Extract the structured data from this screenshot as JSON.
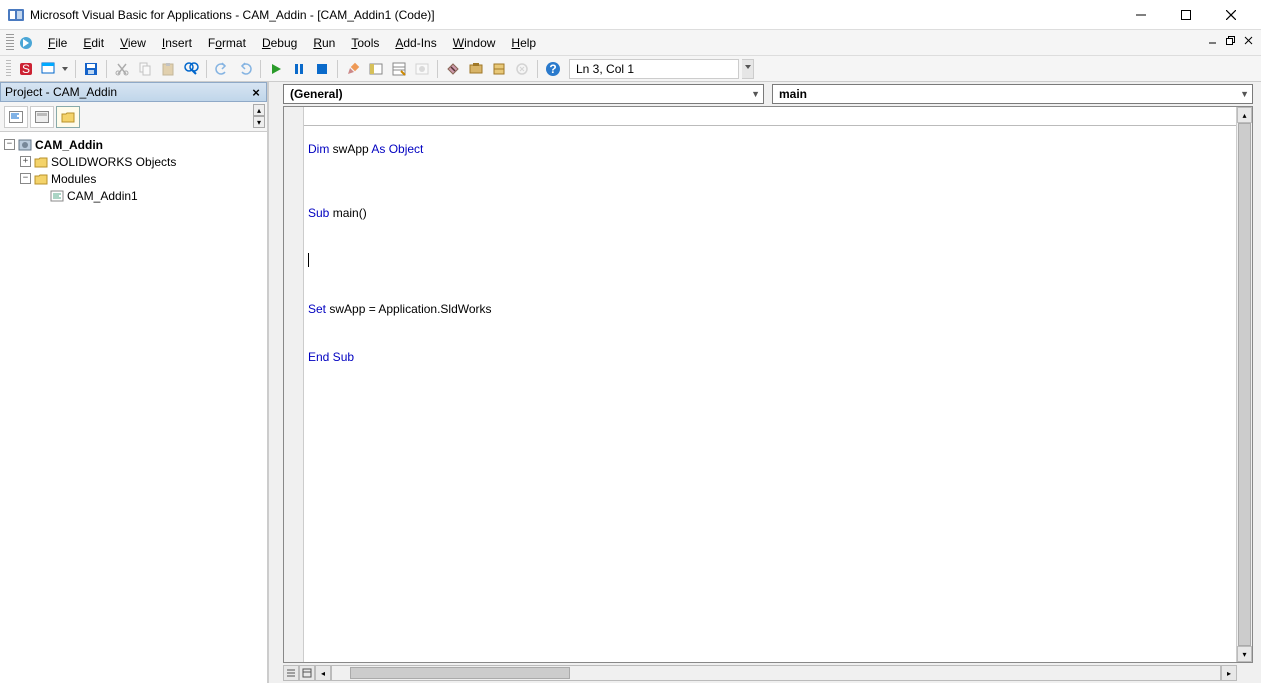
{
  "title": "Microsoft Visual Basic for Applications - CAM_Addin - [CAM_Addin1 (Code)]",
  "menus": {
    "file": "File",
    "edit": "Edit",
    "view": "View",
    "insert": "Insert",
    "format": "Format",
    "debug": "Debug",
    "run": "Run",
    "tools": "Tools",
    "addins": "Add-Ins",
    "window": "Window",
    "help": "Help"
  },
  "menubar_icon_alt": "VBA",
  "status": "Ln 3, Col 1",
  "project_panel_title": "Project - CAM_Addin",
  "tree": {
    "root": "CAM_Addin",
    "folder1": "SOLIDWORKS Objects",
    "folder2": "Modules",
    "module1": "CAM_Addin1"
  },
  "dropdowns": {
    "object": "(General)",
    "procedure": "main"
  },
  "code": {
    "l1a": "Dim",
    "l1b": " swApp ",
    "l1c": "As Object",
    "l2a": "Sub",
    "l2b": " main()",
    "l3": "",
    "l4a": "Set",
    "l4b": " swApp = Application.SldWorks",
    "l5a": "End Sub"
  }
}
